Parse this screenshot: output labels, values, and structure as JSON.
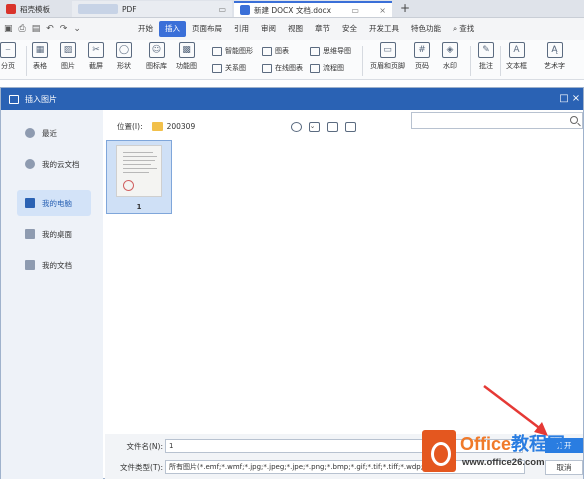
{
  "tabs": [
    {
      "label": "稻壳模板",
      "color": "#d9332b"
    },
    {
      "label": "PDF",
      "color": "#8a9db5"
    },
    {
      "label": "新建 DOCX 文档.docx",
      "color": "#3a6fd8"
    }
  ],
  "new_tab": "+",
  "menu": {
    "items": [
      "开始",
      "插入",
      "页面布局",
      "引用",
      "审阅",
      "视图",
      "章节",
      "安全",
      "开发工具",
      "特色功能"
    ],
    "active": "插入",
    "search": "查找"
  },
  "ribbon": {
    "groups": [
      "分页",
      "表格",
      "图片",
      "截屏",
      "形状",
      "图标库",
      "功能图",
      "页眉和页脚",
      "页码",
      "水印",
      "批注",
      "文本框",
      "艺术字"
    ],
    "small": [
      "智能图形",
      "图表",
      "思维导图",
      "关系图",
      "在线图表",
      "流程图"
    ]
  },
  "dialog": {
    "title": "插入图片",
    "sidebar": [
      "最近",
      "我的云文档",
      "我的电脑",
      "我的桌面",
      "我的文档"
    ],
    "selected": "我的电脑",
    "location_label": "位置(I):",
    "location_value": "200309",
    "search_placeholder": "",
    "files": [
      {
        "name": "1"
      }
    ],
    "filename_label": "文件名(N):",
    "filename_value": "1",
    "filetype_label": "文件类型(T):",
    "filetype_value": "所有图片(*.emf;*.wmf;*.jpg;*.jpeg;*.jpe;*.png;*.bmp;*.gif;*.tif;*.tiff;*.wdp;*.svg)",
    "open_button": "打开",
    "cancel_button": "取消"
  },
  "watermark": {
    "brand": "Office",
    "brand_rest": "教程网",
    "url": "www.office26.com"
  },
  "colors": {
    "accent": "#2a62b4",
    "arrow": "#e53935",
    "brand": "#e4571f"
  }
}
